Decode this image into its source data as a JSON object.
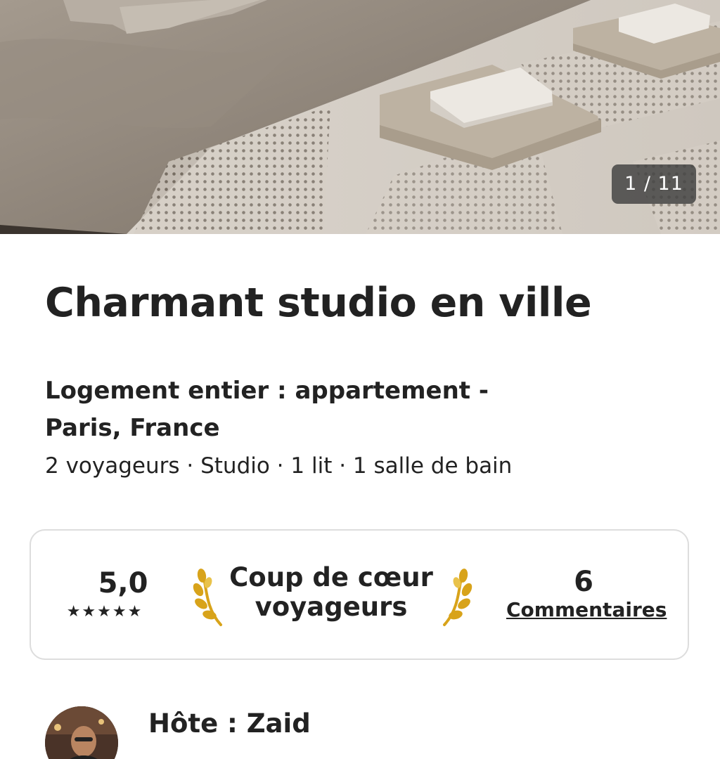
{
  "gallery": {
    "counter": "1 / 11"
  },
  "listing": {
    "title": "Charmant studio en ville",
    "subtitle": "Logement entier : appartement - Paris, France",
    "details": "2 voyageurs · Studio · 1 lit · 1 salle de bain"
  },
  "rating_card": {
    "score": "5,0",
    "stars": "★★★★★",
    "star_count": 5,
    "badge_label": "Coup de cœur voyageurs",
    "reviews_count": "6",
    "reviews_link": "Commentaires"
  },
  "host": {
    "label": "Hôte : Zaid"
  },
  "icons": {
    "laurel_left": "laurel-left-icon",
    "laurel_right": "laurel-right-icon",
    "star": "star-icon"
  },
  "colors": {
    "text": "#222222",
    "laurel_gold": "#d8a31a",
    "card_border": "#dddddd",
    "counter_bg": "#404040"
  }
}
